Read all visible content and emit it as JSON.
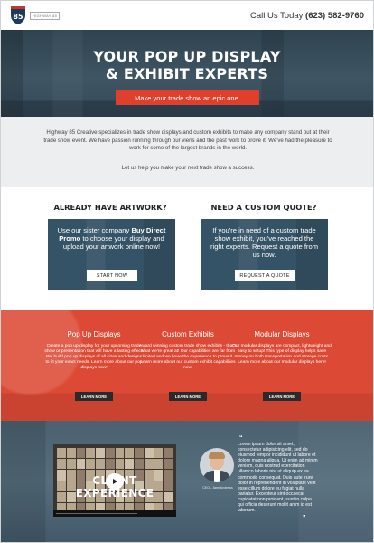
{
  "header": {
    "logo_text": "85",
    "logo_tag": "HIGHWAY 85",
    "phone_prefix": "Call Us Today ",
    "phone_number": "(623) 582-9760"
  },
  "hero": {
    "title_line1": "YOUR POP UP DISPLAY",
    "title_line2": "& EXHIBIT EXPERTS",
    "cta": "Make your trade show an epic one."
  },
  "intro": {
    "paragraph": "Highway 85 Creative specializes in trade show displays and custom exhibits to make any company stand out at their trade show event. We have passion running through our viens and the past work to prove it. We've had the pleasure to work for some of the largest brands in the world.",
    "tagline": "Let us help you make your next trade show a success."
  },
  "artwork": {
    "heading": "ALREADY HAVE ARTWORK?",
    "text_before": "Use our sister company ",
    "brand": "Buy Direct Promo",
    "text_after": " to choose your display and upload your artwork online now!",
    "button": "START NOW"
  },
  "quote_box": {
    "heading": "NEED A CUSTOM QUOTE?",
    "text": "If you're in need of a custom trade show exhibit, you've reached the right experts. Request a quote from us now.",
    "button": "REQUEST A QUOTE"
  },
  "services": [
    {
      "title": "Pop Up Displays",
      "text": "Create a pop up display for your upcoming trade show or presentation that will have a lasting effect! We build pop up displays of all sizes and designs to fit your exact needs. Learn more about our pop displays now!",
      "button": "LEARN MORE"
    },
    {
      "title": "Custom Exhibits",
      "text": "Award winning custom trade show exhibits - that's what we're great at! Our capabilities are far from limited and we have the experience to prove it. Learn more about our custom exhibit capabilities now.",
      "button": "LEARN MORE"
    },
    {
      "title": "Modular Displays",
      "text": "Our modular displays are compact, lightweight and easy to setup! This type of display helps save money on both transportation and storage costs. Learn more about our modular displays here!",
      "button": "LEARN MORE"
    }
  ],
  "client": {
    "video_title": "CLIENT EXPERIENCE",
    "person": "CEO - Jane Andrews",
    "quote": "Lorem ipsum dolor sit amet, consectetur adipisicing elit, sed do eiusmod tempor incididunt ut labore et dolore magna aliqua. Ut enim ad minim veniam, quis nostrud exercitation ullamco laboris nisi ut aliquip ex ea commodo consequat. Duis aute irure dolor in reprehenderit in voluptate velit esse cillum dolore eu fugiat nulla pariatur. Excepteur sint occaecat cupidatat non proident, sunt in culpa qui officia deserunt mollit anim id est laborum."
  },
  "colors": {
    "accent_red": "#dc4a35",
    "hero_blue": "#3f5563",
    "intro_gray": "#eceeef"
  }
}
